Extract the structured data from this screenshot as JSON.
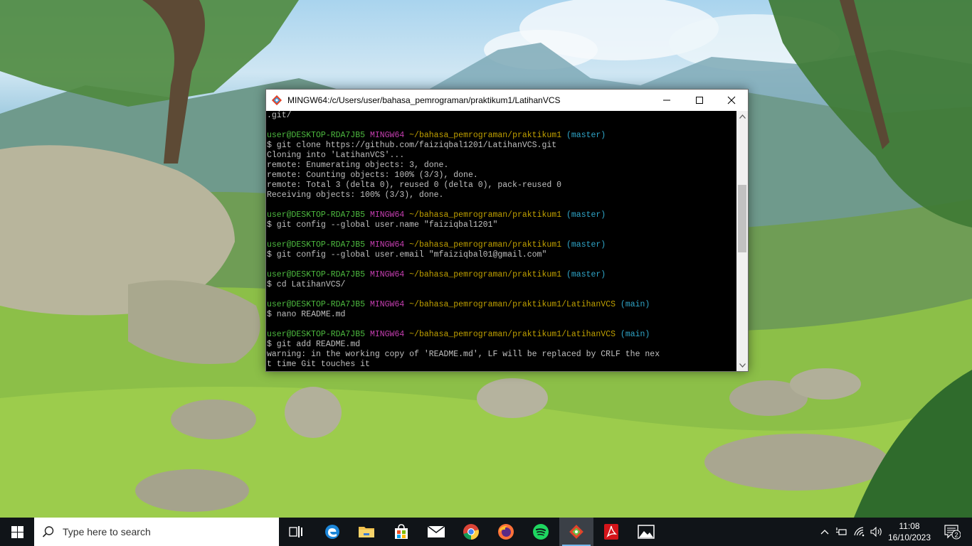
{
  "window": {
    "title": "MINGW64:/c/Users/user/bahasa_pemrograman/praktikum1/LatihanVCS",
    "controls": {
      "minimize": "minimize",
      "maximize": "maximize",
      "close": "close"
    }
  },
  "terminal": {
    "lines": [
      {
        "type": "output",
        "text": ".git/"
      },
      {
        "type": "blank",
        "text": ""
      },
      {
        "type": "prompt",
        "user": "user@DESKTOP-RDA7JB5",
        "system": "MINGW64",
        "path": "~/bahasa_pemrograman/praktikum1",
        "branch": "(master)"
      },
      {
        "type": "output",
        "text": "$ git clone https://github.com/faiziqbal1201/LatihanVCS.git"
      },
      {
        "type": "output",
        "text": "Cloning into 'LatihanVCS'..."
      },
      {
        "type": "output",
        "text": "remote: Enumerating objects: 3, done."
      },
      {
        "type": "output",
        "text": "remote: Counting objects: 100% (3/3), done."
      },
      {
        "type": "output",
        "text": "remote: Total 3 (delta 0), reused 0 (delta 0), pack-reused 0"
      },
      {
        "type": "output",
        "text": "Receiving objects: 100% (3/3), done."
      },
      {
        "type": "blank",
        "text": ""
      },
      {
        "type": "prompt",
        "user": "user@DESKTOP-RDA7JB5",
        "system": "MINGW64",
        "path": "~/bahasa_pemrograman/praktikum1",
        "branch": "(master)"
      },
      {
        "type": "output",
        "text": "$ git config --global user.name \"faiziqbal1201\""
      },
      {
        "type": "blank",
        "text": ""
      },
      {
        "type": "prompt",
        "user": "user@DESKTOP-RDA7JB5",
        "system": "MINGW64",
        "path": "~/bahasa_pemrograman/praktikum1",
        "branch": "(master)"
      },
      {
        "type": "output",
        "text": "$ git config --global user.email \"mfaiziqbal01@gmail.com\""
      },
      {
        "type": "blank",
        "text": ""
      },
      {
        "type": "prompt",
        "user": "user@DESKTOP-RDA7JB5",
        "system": "MINGW64",
        "path": "~/bahasa_pemrograman/praktikum1",
        "branch": "(master)"
      },
      {
        "type": "output",
        "text": "$ cd LatihanVCS/"
      },
      {
        "type": "blank",
        "text": ""
      },
      {
        "type": "prompt",
        "user": "user@DESKTOP-RDA7JB5",
        "system": "MINGW64",
        "path": "~/bahasa_pemrograman/praktikum1/LatihanVCS",
        "branch": "(main)"
      },
      {
        "type": "output",
        "text": "$ nano README.md"
      },
      {
        "type": "blank",
        "text": ""
      },
      {
        "type": "prompt",
        "user": "user@DESKTOP-RDA7JB5",
        "system": "MINGW64",
        "path": "~/bahasa_pemrograman/praktikum1/LatihanVCS",
        "branch": "(main)"
      },
      {
        "type": "output",
        "text": "$ git add README.md"
      },
      {
        "type": "output",
        "text": "warning: in the working copy of 'README.md', LF will be replaced by CRLF the nex"
      },
      {
        "type": "output",
        "text": "t time Git touches it"
      }
    ],
    "colors": {
      "user": "#4dba3f",
      "system": "#c53eb0",
      "path": "#c0a000",
      "branch": "#2fa5c8",
      "text": "#c0c0c0"
    },
    "scroll_position": 0.3
  },
  "taskbar": {
    "search_placeholder": "Type here to search",
    "apps": [
      {
        "name": "task-view",
        "icon": "task-view-icon"
      },
      {
        "name": "edge",
        "icon": "edge-icon"
      },
      {
        "name": "file-explorer",
        "icon": "folder-icon"
      },
      {
        "name": "microsoft-store",
        "icon": "store-icon"
      },
      {
        "name": "mail",
        "icon": "mail-icon"
      },
      {
        "name": "chrome",
        "icon": "chrome-icon"
      },
      {
        "name": "firefox",
        "icon": "firefox-icon"
      },
      {
        "name": "spotify",
        "icon": "spotify-icon"
      },
      {
        "name": "git-bash",
        "icon": "git-icon"
      },
      {
        "name": "acrobat",
        "icon": "pdf-icon"
      },
      {
        "name": "photos",
        "icon": "photos-icon"
      }
    ],
    "clock": {
      "time": "11:08",
      "date": "16/10/2023"
    },
    "notifications_count": "2",
    "accent": "#76b9ed"
  }
}
